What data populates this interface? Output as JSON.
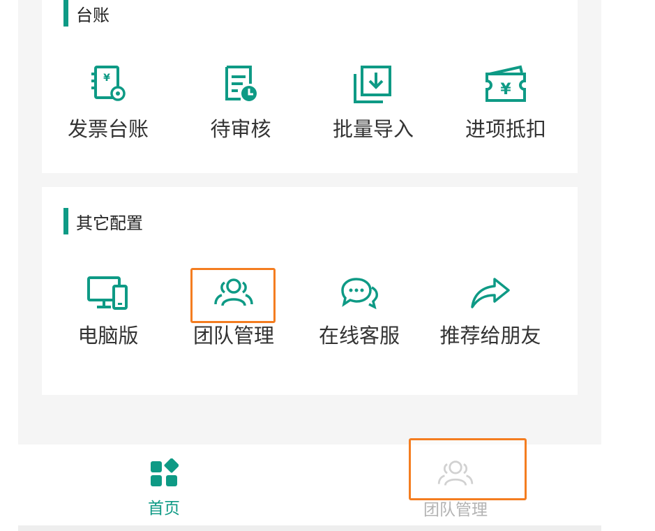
{
  "colors": {
    "accent": "#0e9a85",
    "highlight": "#f47d20",
    "inactive": "#999999"
  },
  "ledger": {
    "title": "台账",
    "items": [
      {
        "label": "发票台账",
        "icon": "invoice-ledger-icon"
      },
      {
        "label": "待审核",
        "icon": "pending-review-icon"
      },
      {
        "label": "批量导入",
        "icon": "batch-import-icon"
      },
      {
        "label": "进项抵扣",
        "icon": "input-deduction-icon"
      }
    ]
  },
  "other": {
    "title": "其它配置",
    "items": [
      {
        "label": "电脑版",
        "icon": "desktop-icon"
      },
      {
        "label": "团队管理",
        "icon": "team-icon"
      },
      {
        "label": "在线客服",
        "icon": "chat-icon"
      },
      {
        "label": "推荐给朋友",
        "icon": "share-icon"
      }
    ]
  },
  "tabbar": {
    "home_label": "首页",
    "team_label": "团队管理",
    "active": "首页"
  }
}
